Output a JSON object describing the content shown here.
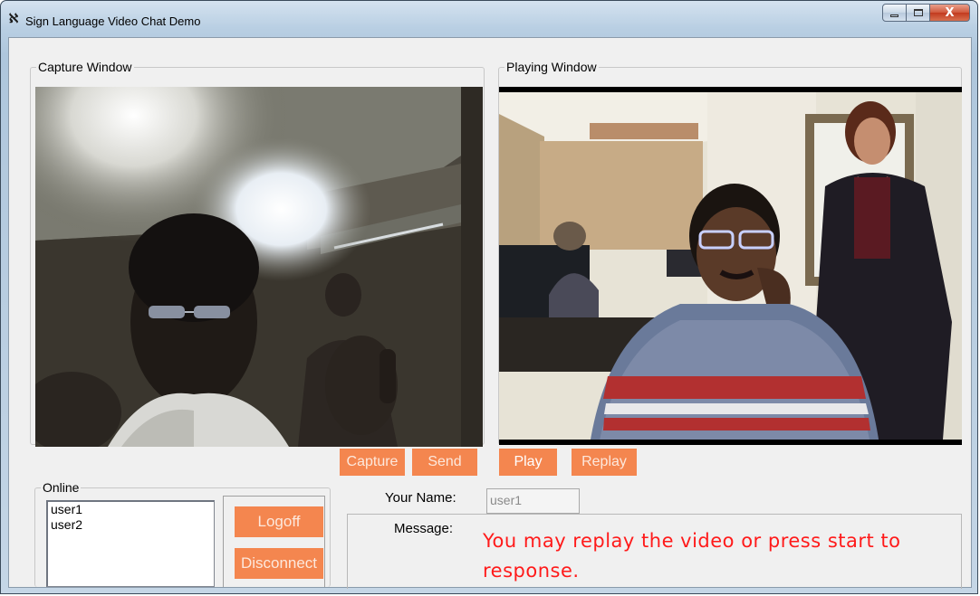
{
  "window": {
    "title": "Sign Language Video Chat Demo",
    "controls": {
      "minimize": "▁",
      "maximize": "☐",
      "close": "X"
    }
  },
  "capture": {
    "group_label": "Capture Window",
    "capture_label": "Capture",
    "send_label": "Send"
  },
  "playing": {
    "group_label": "Playing Window",
    "play_label": "Play",
    "replay_label": "Replay"
  },
  "online": {
    "group_label": "Online",
    "users": [
      "user1",
      "user2"
    ],
    "logoff_label": "Logoff",
    "disconnect_label": "Disconnect"
  },
  "form": {
    "name_label": "Your Name:",
    "name_value": "user1",
    "message_label": "Message:",
    "message_text": "You may replay the video or press start to response."
  },
  "colors": {
    "accent_button": "#f4864f",
    "message_red": "#ff1a1a"
  },
  "icons": {
    "app": "sign-language-app-icon"
  }
}
